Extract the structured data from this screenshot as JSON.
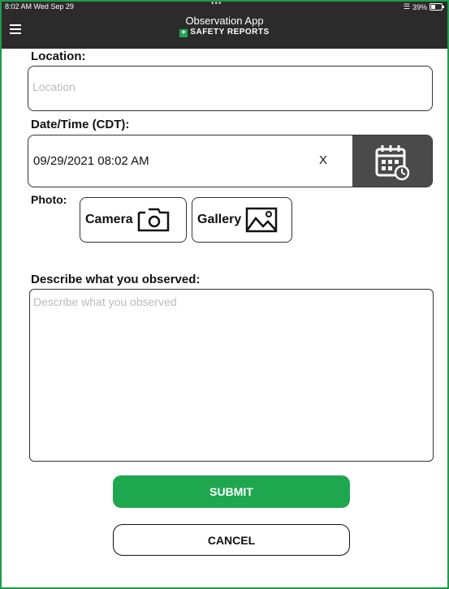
{
  "status_bar": {
    "time": "8:02 AM  Wed Sep 29",
    "dots": "•••",
    "battery": "39%",
    "wifi_icon": "wifi-icon",
    "battery_icon": "battery-icon"
  },
  "header": {
    "title": "Observation App",
    "brand": "SAFETY REPORTS",
    "brand_plus": "+",
    "menu_icon": "hamburger-menu-icon"
  },
  "form": {
    "location_label": "Location:",
    "location_placeholder": "Location",
    "datetime_label": "Date/Time (CDT):",
    "datetime_value": "09/29/2021 08:02 AM",
    "clear_label": "X",
    "calendar_icon": "calendar-icon",
    "photo_label": "Photo:",
    "camera_label": "Camera",
    "gallery_label": "Gallery",
    "describe_label": "Describe what you observed:",
    "describe_placeholder": "Describe what you observed"
  },
  "actions": {
    "submit_label": "SUBMIT",
    "cancel_label": "CANCEL"
  },
  "colors": {
    "accent": "#1fa74f",
    "header_bg": "#2b2b2b",
    "calendar_bg": "#4a4a4a"
  }
}
